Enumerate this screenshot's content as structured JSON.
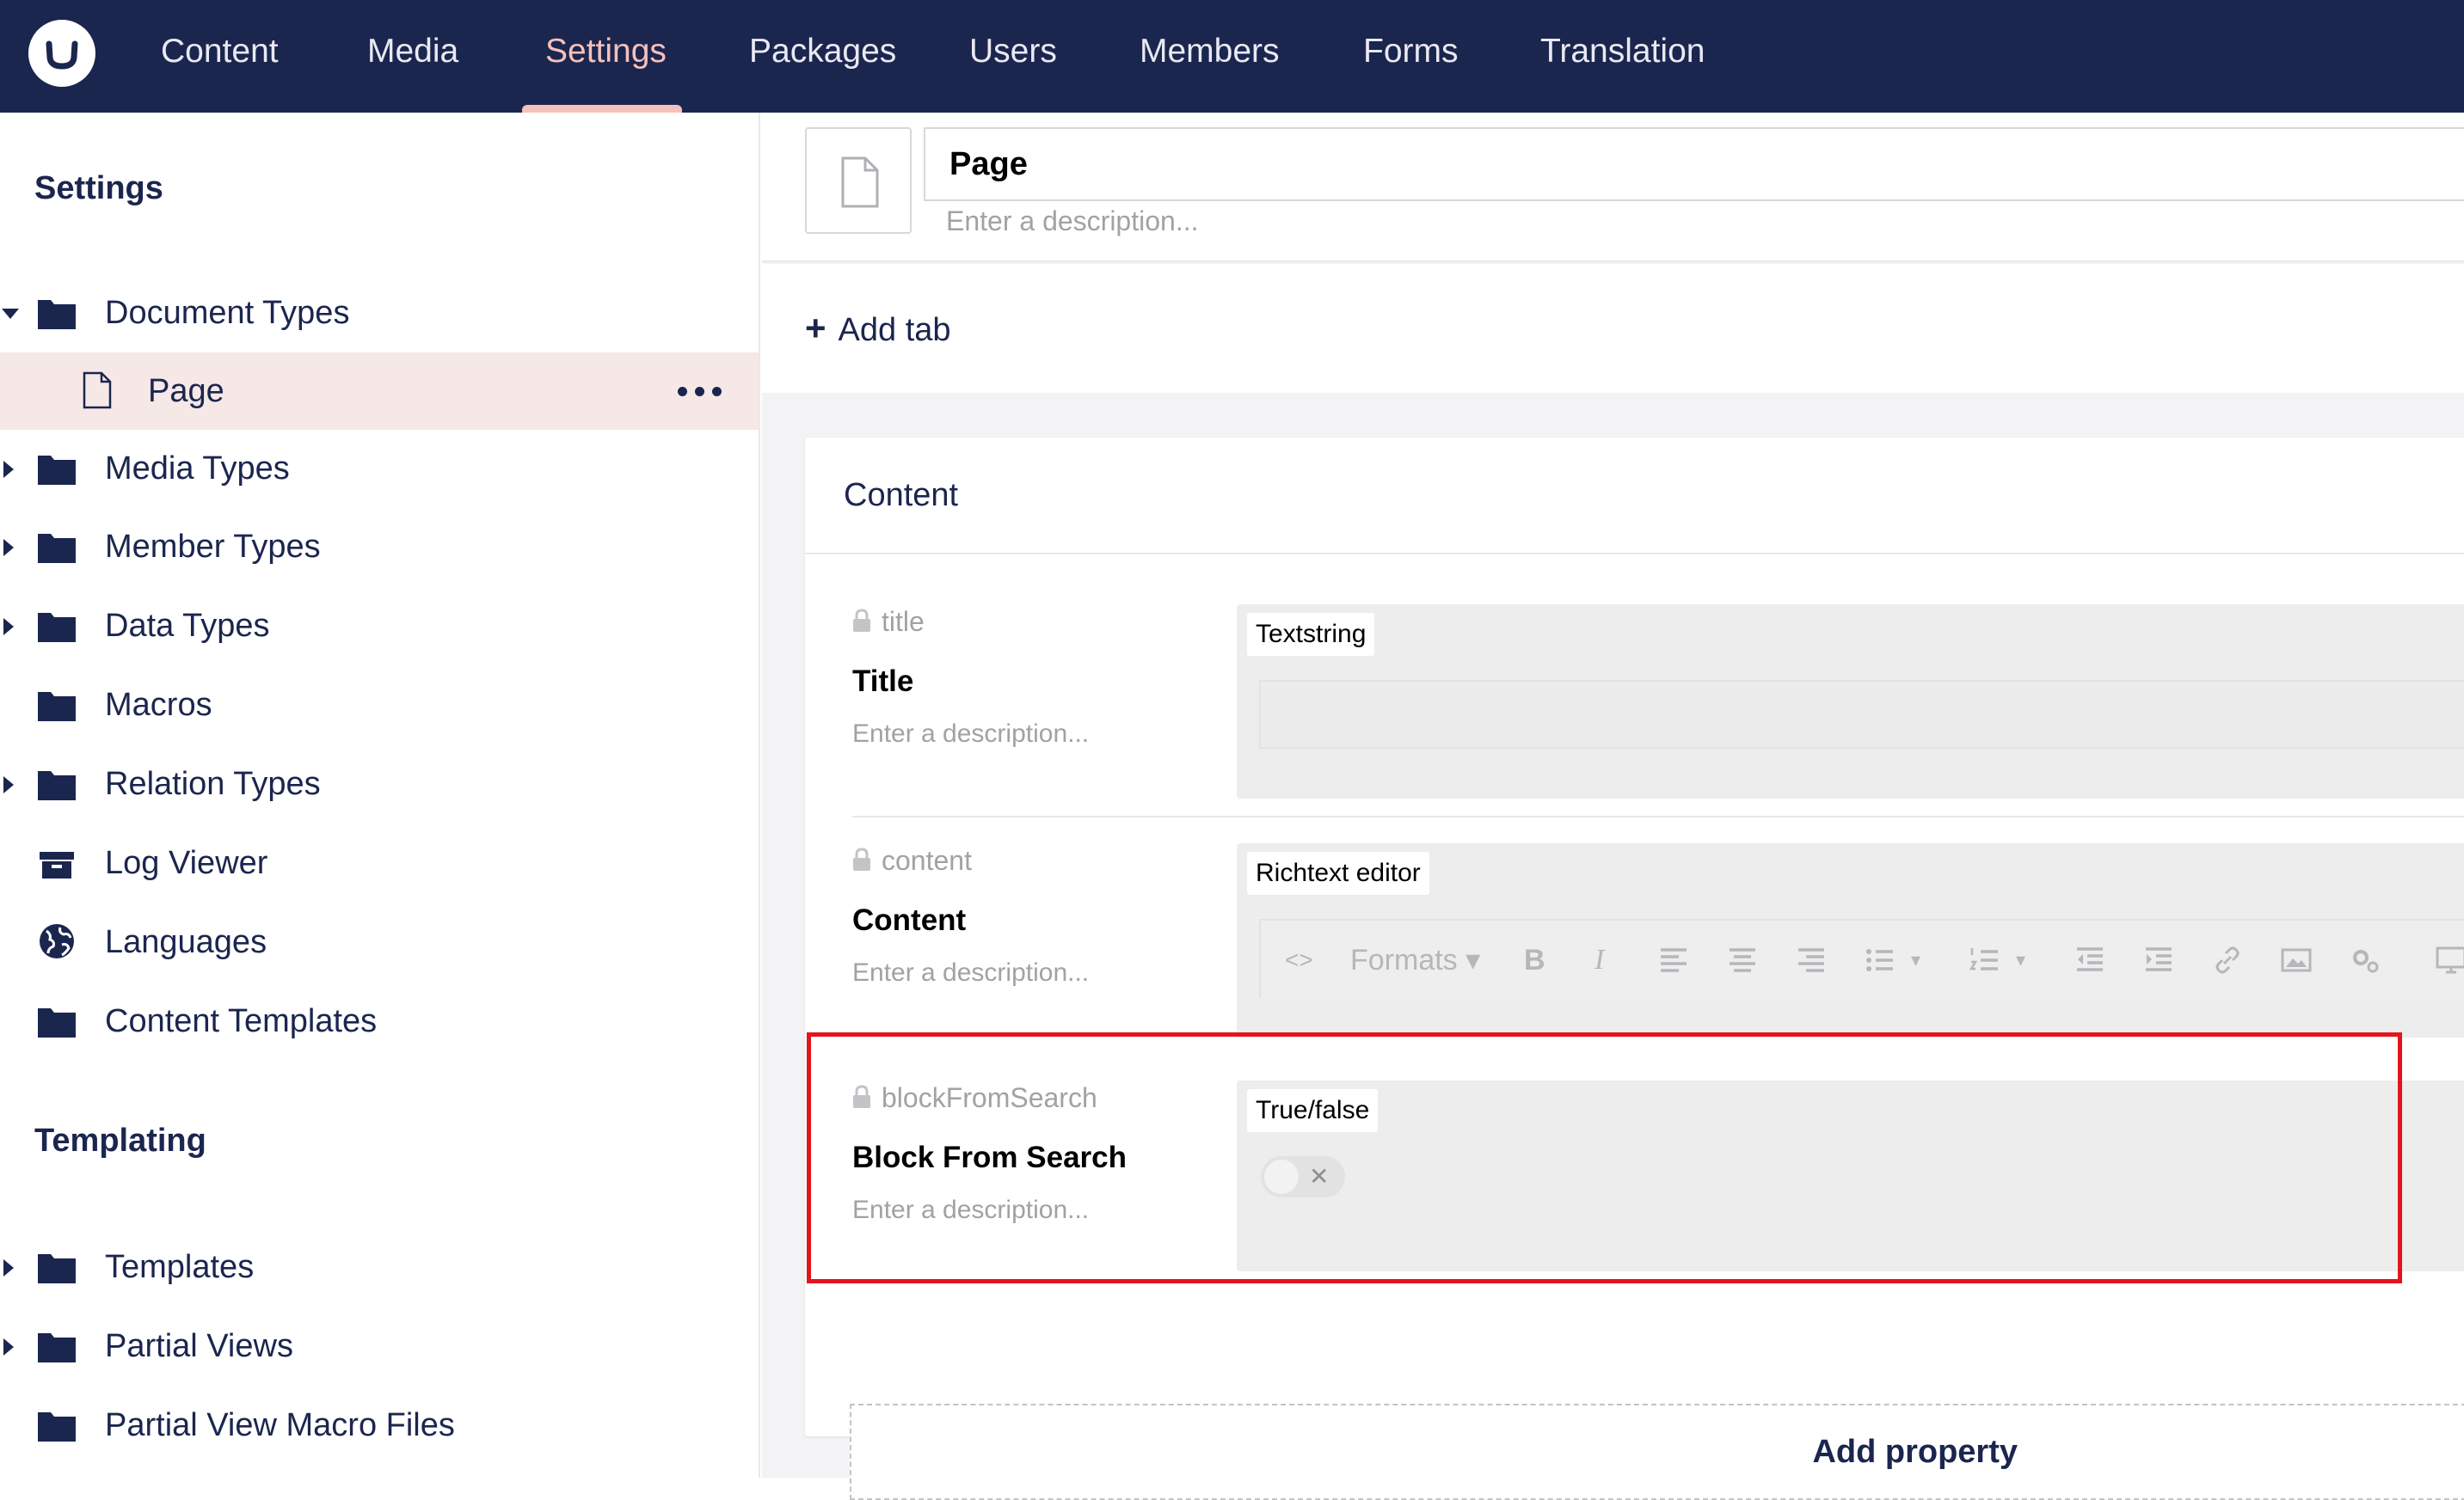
{
  "nav": {
    "items": [
      "Content",
      "Media",
      "Settings",
      "Packages",
      "Users",
      "Members",
      "Forms",
      "Translation"
    ],
    "active": "Settings",
    "background": "#1b264f",
    "active_color": "#f5c1bc"
  },
  "sidebar": {
    "settings_title": "Settings",
    "tree": [
      {
        "label": "Document Types",
        "icon": "folder-icon",
        "expanded": true
      },
      {
        "label": "Page",
        "icon": "document-icon",
        "selected": true
      },
      {
        "label": "Media Types",
        "icon": "folder-icon"
      },
      {
        "label": "Member Types",
        "icon": "folder-icon"
      },
      {
        "label": "Data Types",
        "icon": "folder-icon"
      },
      {
        "label": "Macros",
        "icon": "folder-icon"
      },
      {
        "label": "Relation Types",
        "icon": "folder-icon"
      },
      {
        "label": "Log Viewer",
        "icon": "box-icon"
      },
      {
        "label": "Languages",
        "icon": "globe-icon"
      },
      {
        "label": "Content Templates",
        "icon": "folder-icon"
      }
    ],
    "templating_title": "Templating",
    "templating": [
      {
        "label": "Templates",
        "icon": "folder-icon"
      },
      {
        "label": "Partial Views",
        "icon": "folder-icon"
      },
      {
        "label": "Partial View Macro Files",
        "icon": "folder-icon"
      }
    ]
  },
  "editor": {
    "name_value": "Page",
    "description_placeholder": "Enter a description...",
    "add_tab_label": "Add tab",
    "group_title": "Content",
    "properties": [
      {
        "alias": "title",
        "name": "Title",
        "description": "Enter a description...",
        "editor": "Textstring"
      },
      {
        "alias": "content",
        "name": "Content",
        "description": "Enter a description...",
        "editor": "Richtext editor",
        "toolbar_formats": "Formats"
      },
      {
        "alias": "blockFromSearch",
        "name": "Block From Search",
        "description": "Enter a description...",
        "editor": "True/false",
        "toggle_value": false
      }
    ],
    "add_property_label": "Add property",
    "highlight_color": "#e3141c"
  }
}
